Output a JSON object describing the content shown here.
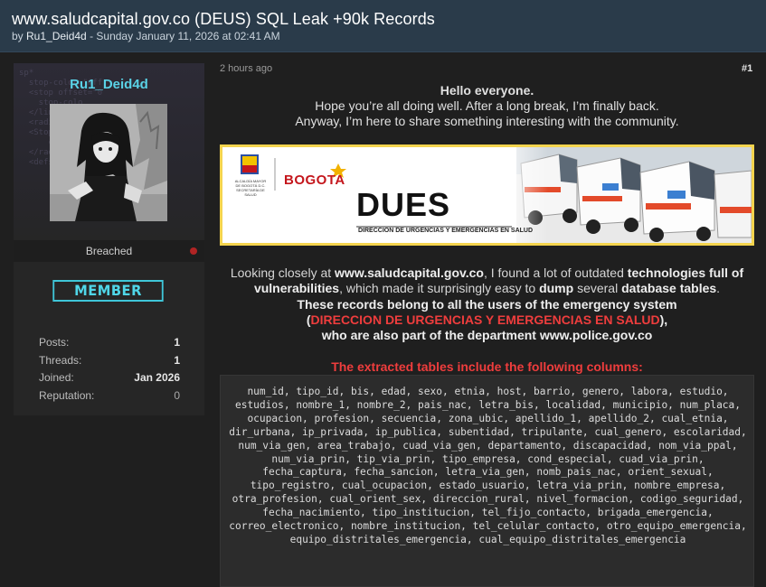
{
  "thread": {
    "title": "www.saludcapital.gov.co (DEUS) SQL Leak +90k Records",
    "byline_prefix": "by ",
    "author": "Ru1_Deid4d",
    "byline_sep": " - ",
    "date": "Sunday January 11, 2026 at 02:41 AM"
  },
  "user": {
    "name": "Ru1_Deid4d",
    "rank": "Breached",
    "badge": "MEMBER",
    "code_bg": "sp*\n  stop-color=\"#ff\n  <stop offset=\"0\n    stop-colo\n  </linearGradient\n  <radialGradi\n  <Stop\n      color-\n  </radialG\n  <defs>\n\n\n\n\n\n\n",
    "stats": [
      {
        "label": "Posts:",
        "value": "1"
      },
      {
        "label": "Threads:",
        "value": "1"
      },
      {
        "label": "Joined:",
        "value": "Jan 2026"
      },
      {
        "label": "Reputation:",
        "value": "0"
      }
    ]
  },
  "post": {
    "time": "2 hours ago",
    "number": "#1",
    "greeting": "Hello everyone.",
    "line2": "Hope you’re all doing well. After a long break, I’m finally back.",
    "line3": "Anyway, I’m here to share something interesting with the community.",
    "banner": {
      "logo_text": "BOGOTA",
      "title": "DUES",
      "subtitle": "DIRECCION DE URGENCIAS Y EMERGENCIAS EN SALUD",
      "seal_text_1": "ALCALDÍA MAYOR",
      "seal_text_2": "DE BOGOTÁ D.C.",
      "seal_text_3": "SECRETARÍA DE SALUD"
    },
    "p1": {
      "t1": "Looking closely at ",
      "site": "www.saludcapital.gov.co",
      "t2": ", I found a lot of outdated ",
      "tech": "technologies full of vulnerabilities",
      "t3": ", which made it surprisingly easy to ",
      "dump": "dump",
      "t4": " several ",
      "db": "database tables",
      "t5": "."
    },
    "p2": "These records belong to all the users of the emergency system",
    "p3_open": "(",
    "p3_red": "DIRECCION DE URGENCIAS Y EMERGENCIAS EN SALUD",
    "p3_close": "),",
    "p4_text": "who are also part of the department ",
    "p4_site": "www.police.gov.co",
    "columns_heading": "The extracted tables include the following columns:",
    "columns": "num_id, tipo_id, bis, edad, sexo, etnia, host, barrio, genero, labora, estudio, estudios, nombre_1, nombre_2, pais_nac, letra_bis, localidad, municipio, num_placa, ocupacion, profesion, secuencia, zona_ubic, apellido_1, apellido_2, cual_etnia, dir_urbana, ip_privada, ip_publica, subentidad, tripulante, cual_genero, escolaridad, num_via_gen, area_trabajo, cuad_via_gen, departamento, discapacidad, nom_via_ppal, num_via_prin, tip_via_prin, tipo_empresa, cond_especial, cuad_via_prin, fecha_captura, fecha_sancion, letra_via_gen, nomb_pais_nac, orient_sexual, tipo_registro, cual_ocupacion, estado_usuario, letra_via_prin, nombre_empresa, otra_profesion, cual_orient_sex, direccion_rural, nivel_formacion, codigo_seguridad, fecha_nacimiento, tipo_institucion, tel_fijo_contacto, brigada_emergencia, correo_electronico, nombre_institucion, tel_celular_contacto, otro_equipo_emergencia, equipo_distritales_emergencia, cual_equipo_distritales_emergencia"
  }
}
